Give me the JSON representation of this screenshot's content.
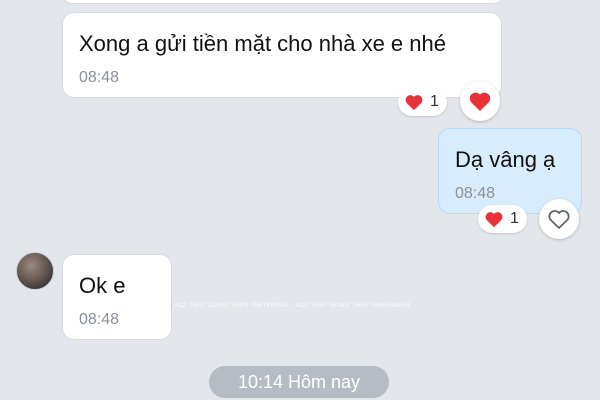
{
  "messages": [
    {
      "text": "Xong a gửi tiền mặt cho nhà xe e nhé",
      "time": "08:48",
      "reaction_count": "1"
    },
    {
      "text": "Dạ vâng ạ",
      "time": "08:48",
      "reaction_count": "1"
    },
    {
      "text": "Ok e",
      "time": "08:48"
    }
  ],
  "watermark": "NỘI THẤT DUNG THUY 0867483534 · NỘI THẤT DUNG THUY 0867483534",
  "date_separator": "10:14 Hôm nay",
  "colors": {
    "background": "#e3e7ec",
    "incoming_bubble": "#ffffff",
    "outgoing_bubble": "#d8ecfd",
    "heart": "#e8323a",
    "date_chip": "#b5bcc4"
  },
  "icons": {
    "reaction": "heart-icon",
    "react_button_filled": "heart-filled-icon",
    "react_button_outline": "heart-outline-icon"
  }
}
